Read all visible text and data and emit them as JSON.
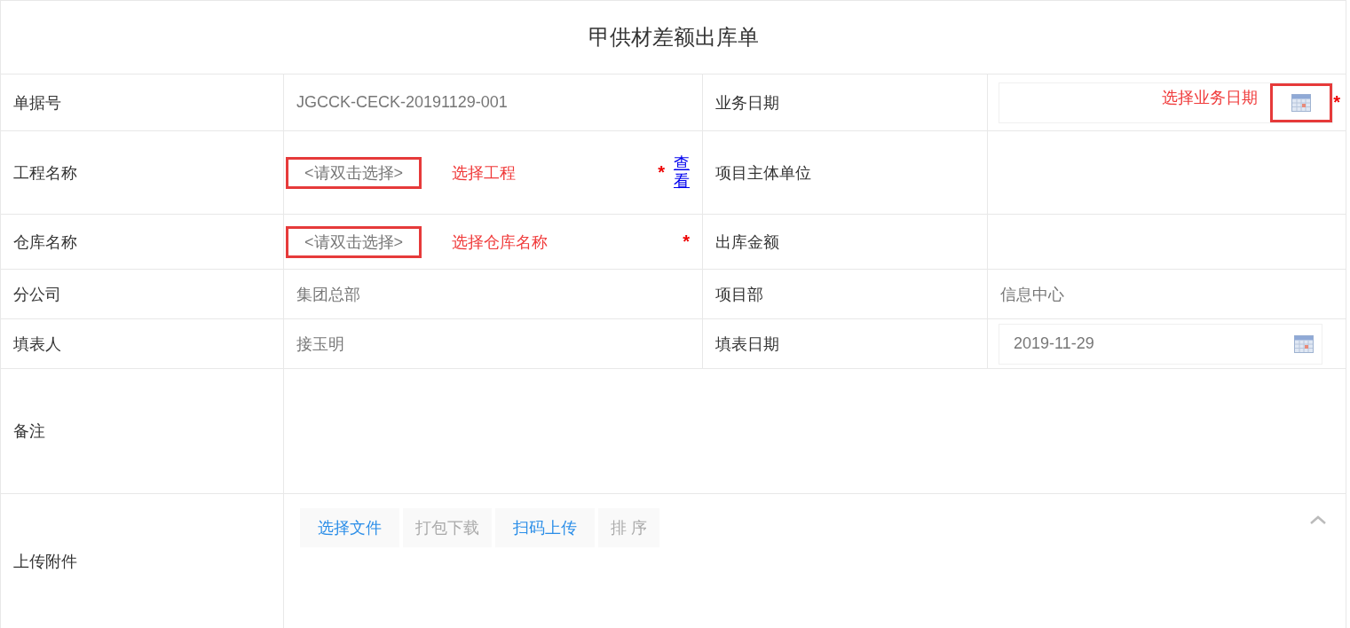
{
  "title": "甲供材差额出库单",
  "rows": [
    {
      "cells": [
        {
          "kind": "label",
          "text": "单据号"
        },
        {
          "kind": "text",
          "text": "JGCCK-CECK-20191129-001"
        },
        {
          "kind": "label",
          "text": "业务日期"
        },
        {
          "kind": "date",
          "annotation": "选择业务日期",
          "highlighted": true,
          "required": "*"
        }
      ]
    },
    {
      "cells": [
        {
          "kind": "label",
          "text": "工程名称"
        },
        {
          "kind": "picker",
          "placeholder": "<请双击选择>",
          "highlighted": true,
          "annotation": "选择工程",
          "required": "*",
          "link": "查看"
        },
        {
          "kind": "label",
          "text": "项目主体单位"
        },
        {
          "kind": "empty"
        }
      ]
    },
    {
      "cells": [
        {
          "kind": "label",
          "text": "仓库名称"
        },
        {
          "kind": "picker",
          "placeholder": "<请双击选择>",
          "highlighted": true,
          "annotation": "选择仓库名称",
          "required": "*"
        },
        {
          "kind": "label",
          "text": "出库金额"
        },
        {
          "kind": "empty"
        }
      ]
    },
    {
      "cells": [
        {
          "kind": "label",
          "text": "分公司"
        },
        {
          "kind": "text",
          "text": "集团总部"
        },
        {
          "kind": "label",
          "text": "项目部"
        },
        {
          "kind": "text",
          "text": "信息中心"
        }
      ]
    },
    {
      "cells": [
        {
          "kind": "label",
          "text": "填表人"
        },
        {
          "kind": "text",
          "text": "接玉明"
        },
        {
          "kind": "label",
          "text": "填表日期"
        },
        {
          "kind": "date",
          "value": "2019-11-29"
        }
      ]
    },
    {
      "cells": [
        {
          "kind": "label",
          "text": "备注"
        },
        {
          "kind": "textarea"
        }
      ]
    },
    {
      "cells": [
        {
          "kind": "label",
          "text": "上传附件"
        },
        {
          "kind": "upload",
          "buttons": [
            {
              "label": "选择文件",
              "disabled": false
            },
            {
              "label": "打包下载",
              "disabled": true
            },
            {
              "label": "扫码上传",
              "disabled": false
            },
            {
              "label": "排 序",
              "disabled": true
            }
          ]
        }
      ]
    }
  ]
}
